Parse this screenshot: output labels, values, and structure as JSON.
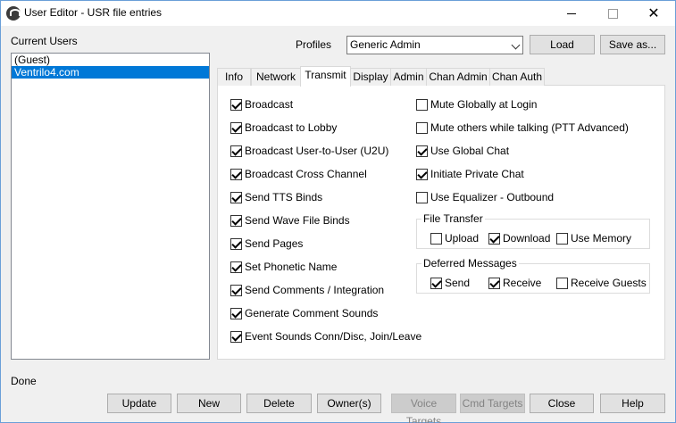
{
  "window": {
    "title": "User Editor - USR file entries",
    "controls": {
      "minimize": "",
      "maximize": "",
      "close": "✕"
    }
  },
  "users": {
    "label": "Current Users",
    "items": [
      "(Guest)",
      "Ventrilo4.com"
    ],
    "selected_index": 1
  },
  "profiles": {
    "label": "Profiles",
    "selected": "Generic Admin",
    "load_label": "Load",
    "save_as_label": "Save as..."
  },
  "tabs": [
    "Info",
    "Network",
    "Transmit",
    "Display",
    "Admin",
    "Chan Admin",
    "Chan Auth"
  ],
  "active_tab": "Transmit",
  "left_options": [
    {
      "label": "Broadcast",
      "checked": true
    },
    {
      "label": "Broadcast to Lobby",
      "checked": true
    },
    {
      "label": "Broadcast User-to-User (U2U)",
      "checked": true
    },
    {
      "label": "Broadcast Cross Channel",
      "checked": true
    },
    {
      "label": "Send TTS Binds",
      "checked": true
    },
    {
      "label": "Send Wave File Binds",
      "checked": true
    },
    {
      "label": "Send Pages",
      "checked": true
    },
    {
      "label": "Set Phonetic Name",
      "checked": true
    },
    {
      "label": "Send Comments / Integration",
      "checked": true
    },
    {
      "label": "Generate Comment Sounds",
      "checked": true
    },
    {
      "label": "Event Sounds Conn/Disc, Join/Leave",
      "checked": true
    }
  ],
  "right_options": [
    {
      "label": "Mute Globally at Login",
      "checked": false
    },
    {
      "label": "Mute others while talking (PTT Advanced)",
      "checked": false
    },
    {
      "label": "Use Global Chat",
      "checked": true
    },
    {
      "label": "Initiate Private Chat",
      "checked": true
    },
    {
      "label": "Use Equalizer - Outbound",
      "checked": false
    }
  ],
  "file_transfer": {
    "title": "File Transfer",
    "options": [
      {
        "label": "Upload",
        "checked": false
      },
      {
        "label": "Download",
        "checked": true
      },
      {
        "label": "Use Memory",
        "checked": false
      }
    ]
  },
  "deferred_messages": {
    "title": "Deferred Messages",
    "options": [
      {
        "label": "Send",
        "checked": true
      },
      {
        "label": "Receive",
        "checked": true
      },
      {
        "label": "Receive Guests",
        "checked": false
      }
    ]
  },
  "status": "Done",
  "footer_buttons": {
    "update": "Update",
    "new": "New",
    "delete": "Delete",
    "owners": "Owner(s)",
    "voice_targets": "Voice Targets",
    "cmd_targets": "Cmd Targets",
    "close": "Close",
    "help": "Help"
  }
}
